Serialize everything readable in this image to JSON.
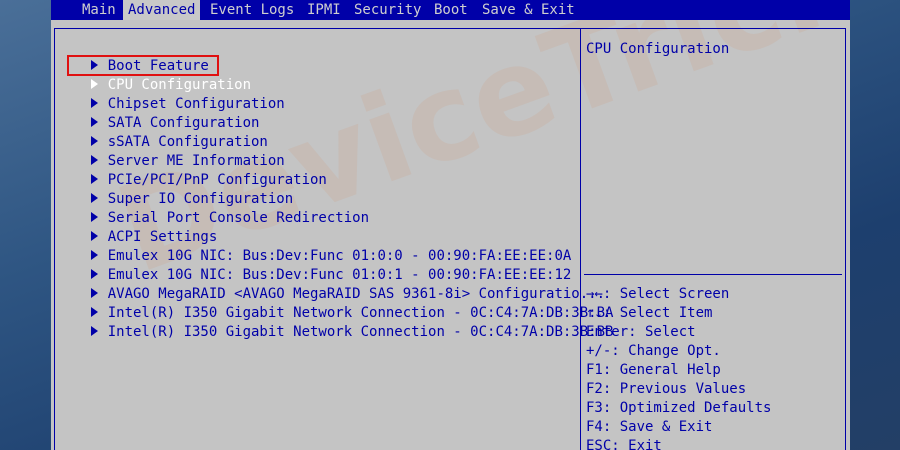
{
  "menubar": {
    "tabs": [
      {
        "label": "Main"
      },
      {
        "label": "Advanced"
      },
      {
        "label": "Event Logs"
      },
      {
        "label": "IPMI"
      },
      {
        "label": "Security"
      },
      {
        "label": "Boot"
      },
      {
        "label": "Save & Exit"
      }
    ],
    "active_tab": "Advanced"
  },
  "items": [
    {
      "label": "Boot Feature"
    },
    {
      "label": "CPU Configuration",
      "selected": true
    },
    {
      "label": "Chipset Configuration"
    },
    {
      "label": "SATA Configuration"
    },
    {
      "label": "sSATA Configuration"
    },
    {
      "label": "Server ME Information"
    },
    {
      "label": "PCIe/PCI/PnP Configuration"
    },
    {
      "label": "Super IO Configuration"
    },
    {
      "label": "Serial Port Console Redirection"
    },
    {
      "label": "ACPI Settings"
    },
    {
      "label": "Emulex 10G NIC: Bus:Dev:Func 01:0:0 - 00:90:FA:EE:EE:0A"
    },
    {
      "label": "Emulex 10G NIC: Bus:Dev:Func 01:0:1 - 00:90:FA:EE:EE:12"
    },
    {
      "label": "AVAGO MegaRAID <AVAGO MegaRAID SAS 9361-8i> Configuratio..."
    },
    {
      "label": "Intel(R) I350 Gigabit Network Connection - 0C:C4:7A:DB:3B:BA"
    },
    {
      "label": "Intel(R) I350 Gigabit Network Connection - 0C:C4:7A:DB:3B:BB"
    }
  ],
  "help": {
    "title": "CPU Configuration",
    "keys": [
      "→←: Select Screen",
      "↑↓: Select Item",
      "Enter: Select",
      "+/-: Change Opt.",
      "F1: General Help",
      "F2: Previous Values",
      "F3: Optimized Defaults",
      "F4: Save & Exit",
      "ESC: Exit"
    ]
  },
  "watermark": "DeviceTricks",
  "colors": {
    "menubar_bg": "#0000a8",
    "panel_bg": "#c4c4c4",
    "text": "#0000a8",
    "highlight_border": "#e01010"
  }
}
